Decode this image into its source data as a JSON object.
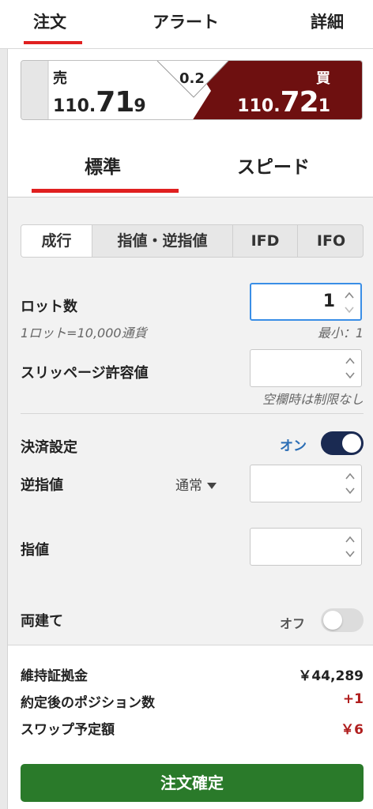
{
  "top_tabs": [
    "注文",
    "アラート",
    "詳細"
  ],
  "price": {
    "sell_label": "売",
    "sell_price_prefix": "110.",
    "sell_price_big": "71",
    "sell_price_suffix": "9",
    "buy_label": "買",
    "buy_price_prefix": "110.",
    "buy_price_big": "72",
    "buy_price_suffix": "1",
    "spread": "0.2"
  },
  "order_tabs": [
    "標準",
    "スピード"
  ],
  "order_types": [
    "成行",
    "指値・逆指値",
    "IFD",
    "IFO"
  ],
  "lot": {
    "label": "ロット数",
    "value": "1",
    "unit_note": "1ロット=10,000通貨",
    "min_note": "最小：1"
  },
  "slippage": {
    "label": "スリッページ許容値",
    "value": "",
    "note": "空欄時は制限なし"
  },
  "settlement": {
    "label": "決済設定",
    "toggle_text": "オン"
  },
  "stop": {
    "label": "逆指値",
    "select_value": "通常",
    "value": ""
  },
  "limit": {
    "label": "指値",
    "value": ""
  },
  "hedge": {
    "label": "両建て",
    "toggle_text": "オフ"
  },
  "summary": {
    "margin_label": "維持証拠金",
    "margin_value": "￥44,289",
    "positions_label": "約定後のポジション数",
    "positions_value": "+1",
    "swap_label": "スワップ予定額",
    "swap_value": "￥6"
  },
  "confirm_label": "注文確定",
  "colors": {
    "accent_red": "#e02020",
    "buy_bg": "#6e1010",
    "confirm_green": "#2a7a2a",
    "toggle_on": "#1a2a52",
    "focus_blue": "#3a8ee6"
  }
}
